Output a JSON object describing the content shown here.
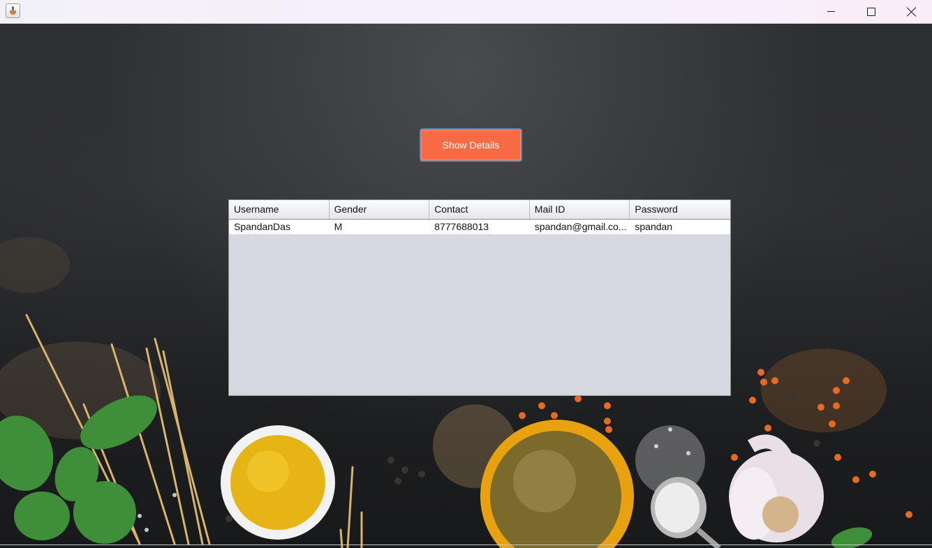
{
  "window": {
    "icon": "java-cup-icon",
    "controls": {
      "minimize": "minimize-icon",
      "maximize": "maximize-icon",
      "close": "close-icon"
    }
  },
  "main": {
    "show_details_label": "Show Details",
    "accent_color": "#f86a44"
  },
  "table": {
    "columns": [
      "Username",
      "Gender",
      "Contact",
      "Mail ID",
      "Password"
    ],
    "rows": [
      [
        "SpandanDas",
        "M",
        "8777688013",
        "spandan@gmail.co...",
        "spandan"
      ]
    ]
  }
}
